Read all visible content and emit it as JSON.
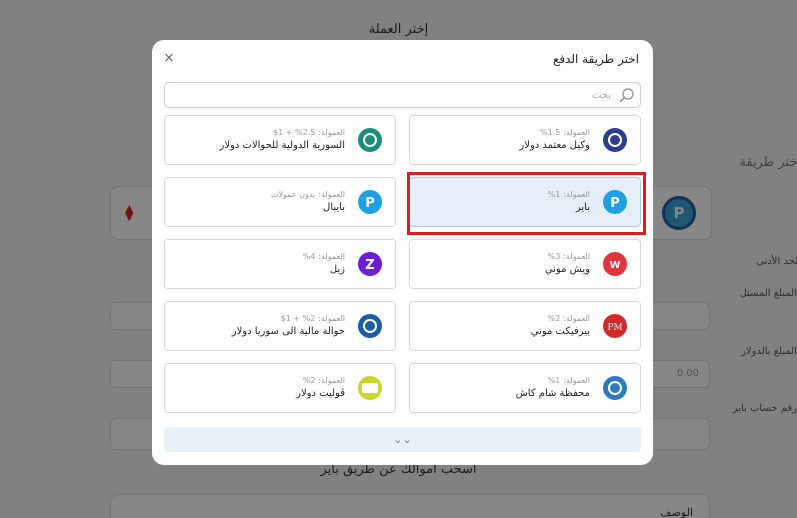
{
  "background": {
    "page_heading": "إختر العملة",
    "side_label": "إختر طريقة",
    "min_limit_label": "الحد الأدنى",
    "amount_label": "المبلغ المستل",
    "usd_amount_label": "المبلغ بالدولار",
    "usd_amount_value": "0.00",
    "account_label": "رقم حساب باير",
    "withdraw_text": "أسحب أموالك عن طريق باير",
    "description_label": "الوصف",
    "selected_method_logo": "P"
  },
  "modal": {
    "title": "اختر طريقة الدفع",
    "close_label": "×",
    "search_placeholder": "بحث",
    "fee_label": "العمولة:",
    "more_label": "⌄⌄",
    "methods": [
      {
        "name": "وكيل معتمد دولار",
        "fee": "1.5%",
        "icon": "agent-handshake-icon",
        "color": "#2c3e91"
      },
      {
        "name": "السورية الدولية للحوالات دولار",
        "fee": "2.5% + 1$",
        "icon": "syrian-international-globe-icon",
        "color": "#1a8c7c"
      },
      {
        "name": "باير",
        "fee": "1%",
        "icon": "payeer-icon",
        "color": "#1da1e6",
        "selected": true
      },
      {
        "name": "بايبال",
        "fee": "بدون عمولات",
        "icon": "paypal-icon",
        "color": "#1da1e6"
      },
      {
        "name": "ويش موني",
        "fee": "3%",
        "icon": "wish-money-icon",
        "color": "#e3343c"
      },
      {
        "name": "زيل",
        "fee": "4%",
        "icon": "zelle-icon",
        "color": "#6d1ed4"
      },
      {
        "name": "بيرفيكت موني",
        "fee": "2%",
        "icon": "perfect-money-icon",
        "color": "#d22a2a"
      },
      {
        "name": "حوالة مالية الى سوريا دولار",
        "fee": "2% + 1$",
        "icon": "money-transfer-syria-icon",
        "color": "#1b5ea8"
      },
      {
        "name": "محفظة شام كاش",
        "fee": "1%",
        "icon": "sham-cash-wallet-icon",
        "color": "#2a7bbf"
      },
      {
        "name": "ڤوليت دولار",
        "fee": "2%",
        "icon": "volet-icon",
        "color": "#c7d62a"
      }
    ]
  }
}
